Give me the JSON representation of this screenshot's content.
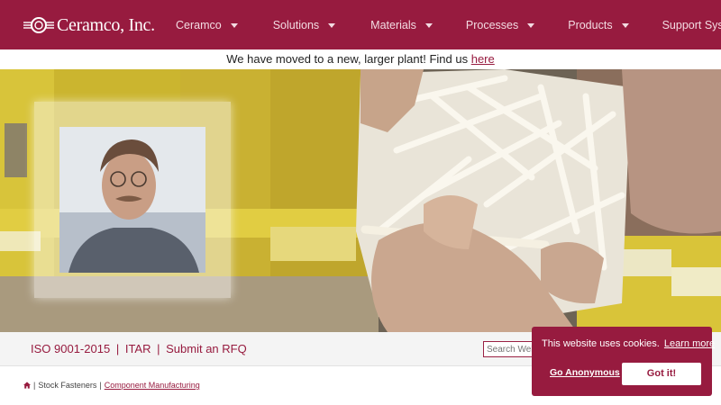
{
  "brand": {
    "name": "Ceramco, Inc.",
    "accent": "#971b3f",
    "icon": "logo-mark"
  },
  "nav": {
    "items": [
      {
        "label": "Ceramco"
      },
      {
        "label": "Solutions"
      },
      {
        "label": "Materials"
      },
      {
        "label": "Processes"
      },
      {
        "label": "Products"
      },
      {
        "label": "Support Systems"
      }
    ]
  },
  "announcement": {
    "text": "We have moved to a new, larger plant! Find us ",
    "link": "here"
  },
  "infobar": {
    "iso": "ISO 9001-2015",
    "itar": "ITAR",
    "rfq": "Submit an RFQ",
    "separator": "|",
    "search_placeholder": "Search Website"
  },
  "breadcrumb": {
    "current": "Stock Fasteners",
    "separator": "|",
    "link": "Component Manufacturing",
    "home_icon": "home-icon"
  },
  "cookie": {
    "message": "This website uses cookies.",
    "learn_more": "Learn more",
    "anonymous": "Go Anonymous",
    "accept": "Got it!"
  }
}
